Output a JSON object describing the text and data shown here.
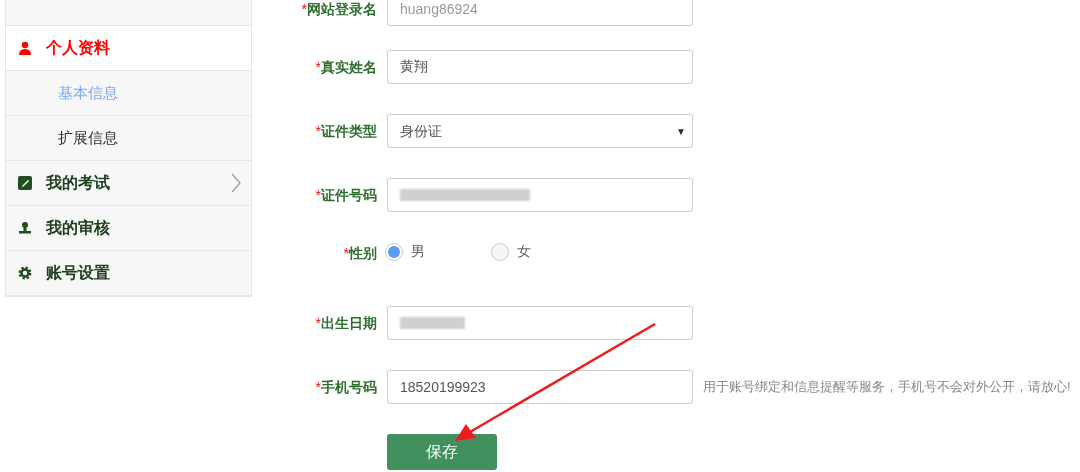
{
  "sidebar": {
    "items": [
      {
        "label": "个人资料",
        "selected": true,
        "arrow": false,
        "children": [
          {
            "label": "基本信息",
            "selected": true
          },
          {
            "label": "扩展信息",
            "selected": false
          }
        ]
      },
      {
        "label": "我的考试",
        "selected": false,
        "arrow": true
      },
      {
        "label": "我的审核",
        "selected": false,
        "arrow": false
      },
      {
        "label": "账号设置",
        "selected": false,
        "arrow": false
      }
    ]
  },
  "form": {
    "fields": [
      {
        "kind": "text",
        "required_mark": "*",
        "label": "网站登录名",
        "value": "huang86924",
        "disabled": true
      },
      {
        "kind": "text",
        "required_mark": "*",
        "label": "真实姓名",
        "value": "黄翔",
        "disabled": false
      },
      {
        "kind": "select",
        "required_mark": "*",
        "label": "证件类型",
        "value": "身份证",
        "caret": "▼"
      },
      {
        "kind": "blurred",
        "required_mark": "*",
        "label": "证件号码"
      },
      {
        "kind": "radio",
        "required_mark": "*",
        "label": "性别",
        "options": [
          {
            "label": "男",
            "selected": true
          },
          {
            "label": "女",
            "selected": false
          }
        ]
      },
      {
        "kind": "blurred",
        "required_mark": "*",
        "label": "出生日期"
      },
      {
        "kind": "text",
        "required_mark": "*",
        "label": "手机号码",
        "value": "18520199923",
        "disabled": false,
        "hint": "用于账号绑定和信息提醒等服务，手机号不会对外公开，请放心!"
      }
    ],
    "submit": "保存"
  }
}
